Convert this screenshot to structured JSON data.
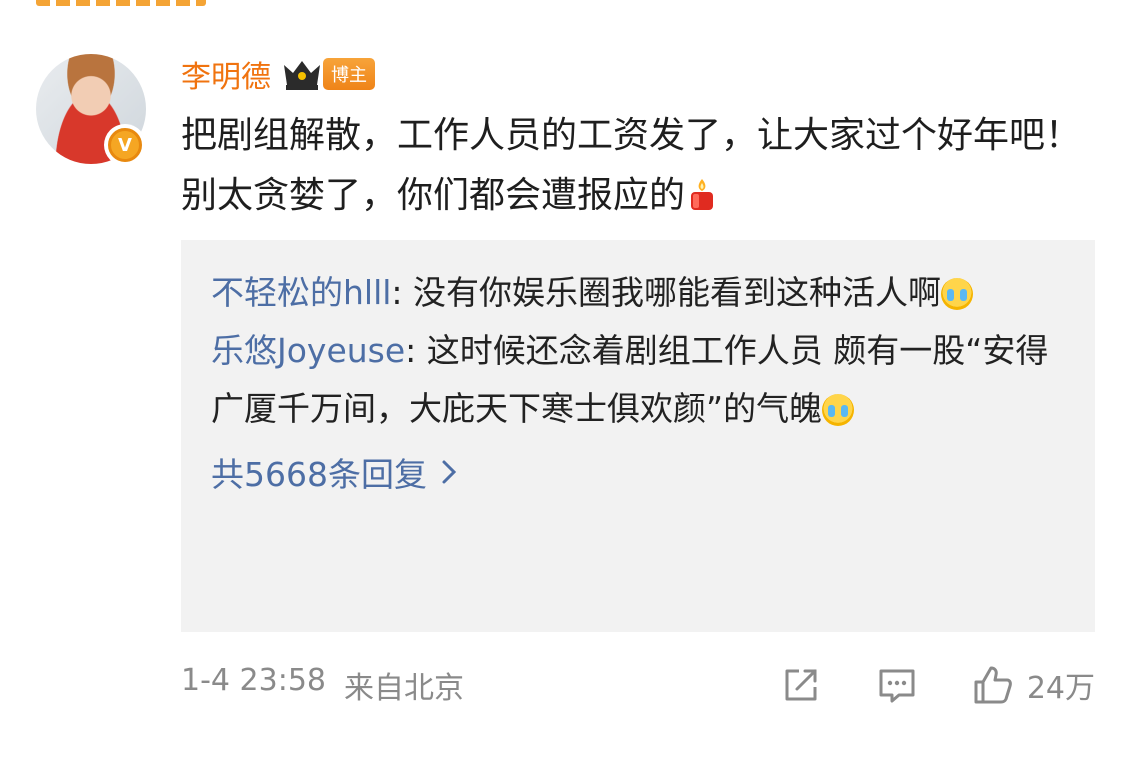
{
  "post": {
    "username": "李明德",
    "badge": "博主",
    "content": "把剧组解散，工作人员的工资发了，让大家过个好年吧！别太贪婪了，你们都会遭报应的"
  },
  "replies": {
    "items": [
      {
        "user": "不轻松的hlll",
        "sep": ": ",
        "text": "没有你娱乐圈我哪能看到这种活人啊"
      },
      {
        "user": "乐悠Joyeuse",
        "sep": ": ",
        "text": "这时候还念着剧组工作人员 颇有一股“安得广厦千万间，大庇天下寒士俱欢颜”的气魄"
      }
    ],
    "more_label": "共5668条回复"
  },
  "footer": {
    "time": "1-4 23:58",
    "location": "来自北京",
    "like_count": "24万"
  },
  "icons": {
    "verified": "V",
    "crown": "crown-icon",
    "candle": "candle-icon",
    "emoji": "crying-emoji-icon",
    "share": "share-icon",
    "comment": "comment-icon",
    "like": "thumbs-up-icon"
  },
  "colors": {
    "username": "#f0730f",
    "link": "#4d6ea5",
    "muted": "#8a8a8a",
    "reply_bg": "#f2f2f2"
  }
}
